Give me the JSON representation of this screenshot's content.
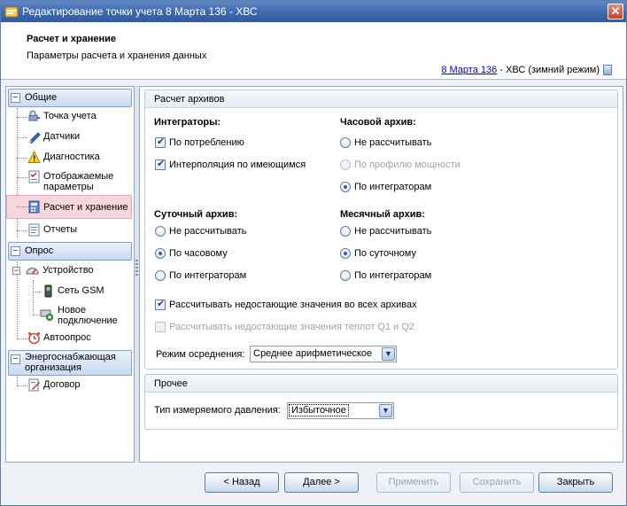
{
  "window": {
    "title": "Редактирование точки учета 8 Марта 136 - ХВС",
    "close_label": "✕"
  },
  "header": {
    "title": "Расчет и хранение",
    "subtitle": "Параметры расчета и хранения данных",
    "link_text": "8 Марта 136",
    "link_suffix": " - ХВС (зимний режим)"
  },
  "sidebar": {
    "groups": [
      {
        "label": "Общие",
        "items": [
          "Точка учета",
          "Датчики",
          "Диагностика",
          "Отображаемые параметры",
          "Расчет и хранение",
          "Отчеты"
        ]
      },
      {
        "label": "Опрос",
        "items": [
          "Устройство",
          "Сеть GSM",
          "Новое подключение",
          "Автоопрос"
        ]
      },
      {
        "label": "Энергоснабжающая организация",
        "items": [
          "Договор"
        ]
      }
    ],
    "selected": "Расчет и хранение"
  },
  "archives": {
    "title": "Расчет архивов",
    "integrators": {
      "label": "Интеграторы:",
      "options": [
        {
          "text": "По потреблению",
          "checked": true
        },
        {
          "text": "Интерполяция по имеющимся",
          "checked": true
        }
      ]
    },
    "hourly": {
      "label": "Часовой архив:",
      "options": [
        {
          "text": "Не рассчитывать",
          "selected": false
        },
        {
          "text": "По профилю мощности",
          "selected": false,
          "disabled": true
        },
        {
          "text": "По интеграторам",
          "selected": true
        }
      ]
    },
    "daily": {
      "label": "Суточный архив:",
      "options": [
        {
          "text": "Не рассчитывать",
          "selected": false
        },
        {
          "text": "По часовому",
          "selected": true
        },
        {
          "text": "По интеграторам",
          "selected": false
        }
      ]
    },
    "monthly": {
      "label": "Месячный архив:",
      "options": [
        {
          "text": "Не рассчитывать",
          "selected": false
        },
        {
          "text": "По суточному",
          "selected": true
        },
        {
          "text": "По интеграторам",
          "selected": false
        }
      ]
    },
    "calc_missing_all": {
      "text": "Рассчитывать недостающие значения во всех архивах",
      "checked": true
    },
    "calc_missing_heat": {
      "text": "Рассчитывать недостающие значения теплот Q1 и Q2",
      "checked": false,
      "disabled": true
    },
    "averaging": {
      "label": "Режим осреднения:",
      "value": "Среднее арифметическое"
    }
  },
  "other": {
    "title": "Прочее",
    "pressure": {
      "label": "Тип измеряемого давления:",
      "value": "Избыточное"
    }
  },
  "buttons": {
    "back": "< Назад",
    "next": "Далее >",
    "apply": "Применить",
    "save": "Сохранить",
    "close": "Закрыть"
  }
}
